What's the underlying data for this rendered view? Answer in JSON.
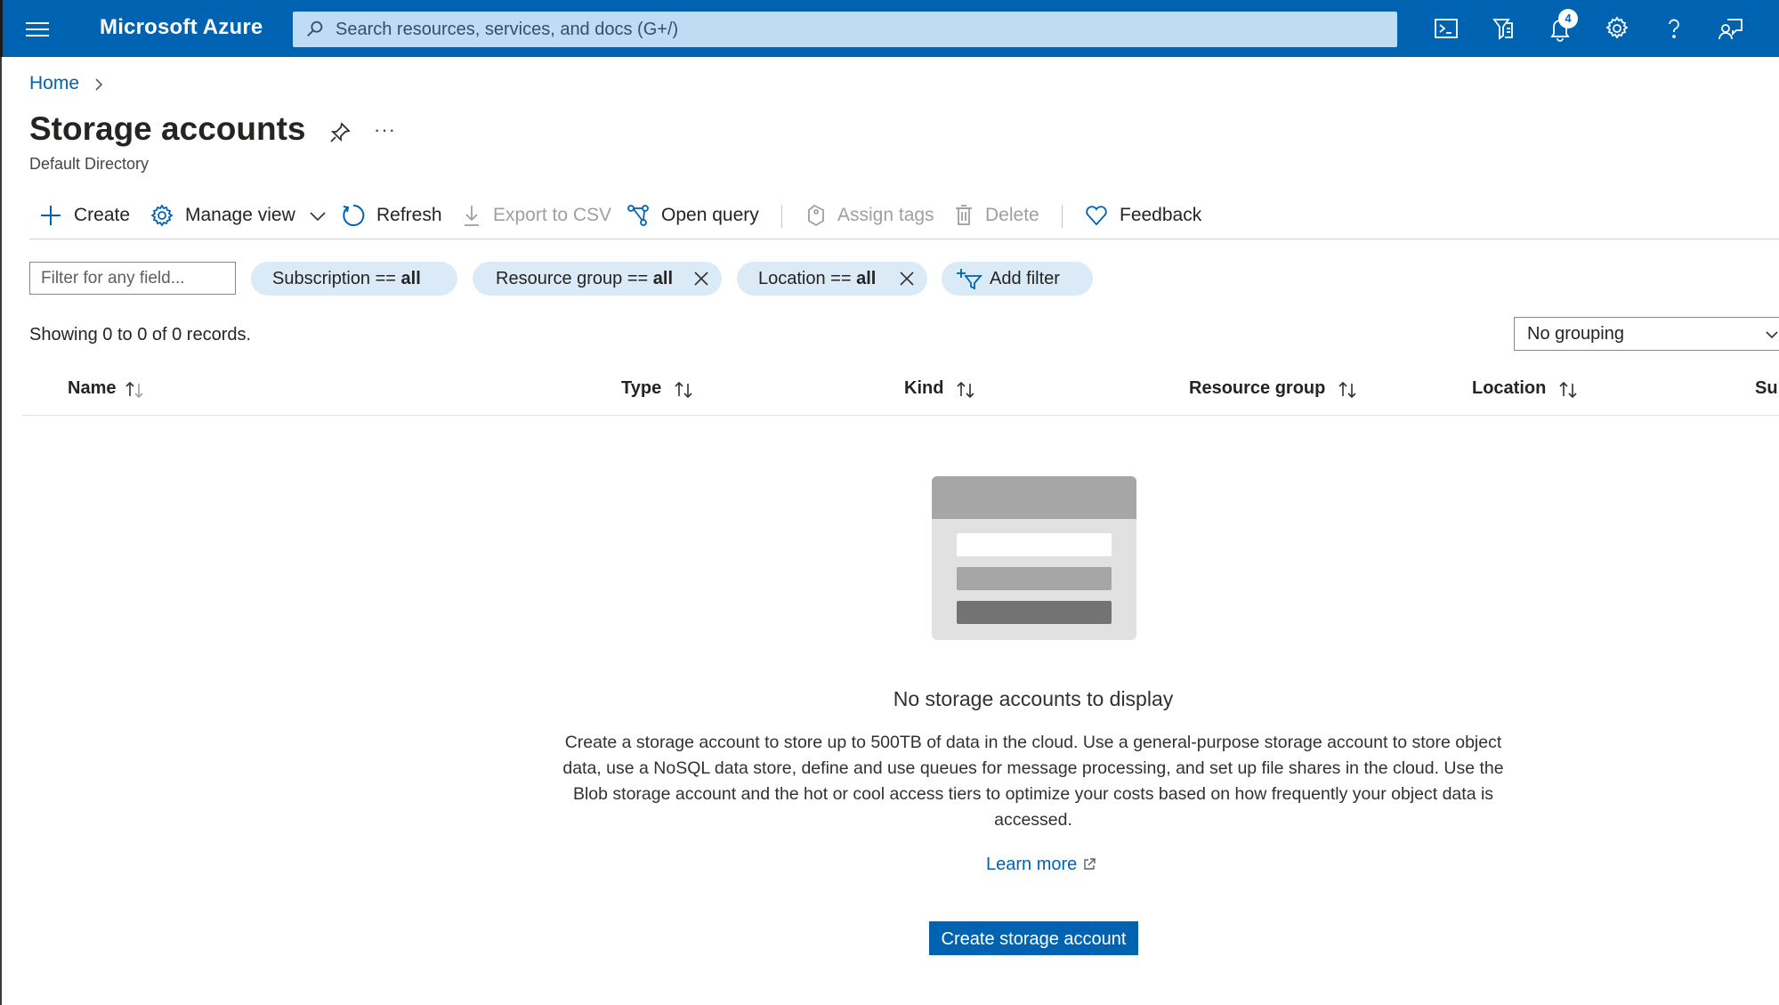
{
  "topbar": {
    "brand": "Microsoft Azure",
    "search_placeholder": "Search resources, services, and docs (G+/)",
    "notification_count": "4",
    "icons": [
      "cloud-shell-icon",
      "directory-filter-icon",
      "bell-icon",
      "gear-icon",
      "help-icon",
      "feedback-person-icon"
    ]
  },
  "breadcrumb": {
    "home": "Home"
  },
  "page": {
    "title": "Storage accounts",
    "subtitle": "Default Directory",
    "more": "···"
  },
  "toolbar": {
    "create": "Create",
    "manage_view": "Manage view",
    "refresh": "Refresh",
    "export_csv": "Export to CSV",
    "open_query": "Open query",
    "assign_tags": "Assign tags",
    "delete": "Delete",
    "feedback": "Feedback"
  },
  "filters": {
    "placeholder": "Filter for any field...",
    "subscription": {
      "label": "Subscription == ",
      "value": "all"
    },
    "resource_group": {
      "label": "Resource group == ",
      "value": "all"
    },
    "location": {
      "label": "Location == ",
      "value": "all"
    },
    "add_filter": "Add filter"
  },
  "records": "Showing 0 to 0 of 0 records.",
  "grouping": {
    "selected": "No grouping"
  },
  "table": {
    "columns": [
      "Name",
      "Type",
      "Kind",
      "Resource group",
      "Location",
      "Su"
    ]
  },
  "empty": {
    "title": "No storage accounts to display",
    "description": "Create a storage account to store up to 500TB of data in the cloud. Use a general-purpose storage account to store object data, use a NoSQL data store, define and use queues for message processing, and set up file shares in the cloud. Use the Blob storage account and the hot or cool access tiers to optimize your costs based on how frequently your object data is accessed.",
    "learn_more": "Learn more",
    "create_button": "Create storage account"
  },
  "colors": {
    "azure_blue": "#0063b1",
    "pill_bg": "#dbeaf7",
    "search_bg": "#bfdcf5"
  }
}
